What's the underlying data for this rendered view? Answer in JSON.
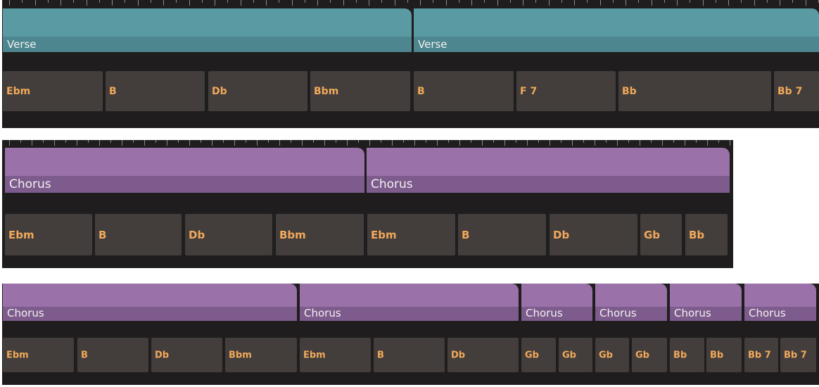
{
  "colors": {
    "verse": "#5a9aa3",
    "verse_band": "#4e8690",
    "chorus": "#9a72a9",
    "chorus_band": "#7d5b8c",
    "chord_bg": "#433e3c",
    "chord_text": "#f2a95a",
    "track_bg": "#1f1d1e"
  },
  "rows": [
    {
      "sections": [
        {
          "label": "Verse",
          "type": "verse"
        },
        {
          "label": "Verse",
          "type": "verse"
        }
      ],
      "chords": [
        "Ebm",
        "B",
        "Db",
        "Bbm",
        "B",
        "F 7",
        "Bb",
        "Bb 7"
      ]
    },
    {
      "sections": [
        {
          "label": "Chorus",
          "type": "chorus"
        },
        {
          "label": "Chorus",
          "type": "chorus"
        }
      ],
      "chords": [
        "Ebm",
        "B",
        "Db",
        "Bbm",
        "Ebm",
        "B",
        "Db",
        "Gb",
        "Bb"
      ]
    },
    {
      "sections": [
        {
          "label": "Chorus",
          "type": "chorus"
        },
        {
          "label": "Chorus",
          "type": "chorus"
        },
        {
          "label": "Chorus",
          "type": "chorus"
        },
        {
          "label": "Chorus",
          "type": "chorus"
        },
        {
          "label": "Chorus",
          "type": "chorus"
        },
        {
          "label": "Chorus",
          "type": "chorus"
        }
      ],
      "chords": [
        "Ebm",
        "B",
        "Db",
        "Bbm",
        "Ebm",
        "B",
        "Db",
        "Gb",
        "Gb",
        "Gb",
        "Gb",
        "Bb",
        "Bb",
        "Bb 7",
        "Bb 7"
      ]
    }
  ]
}
